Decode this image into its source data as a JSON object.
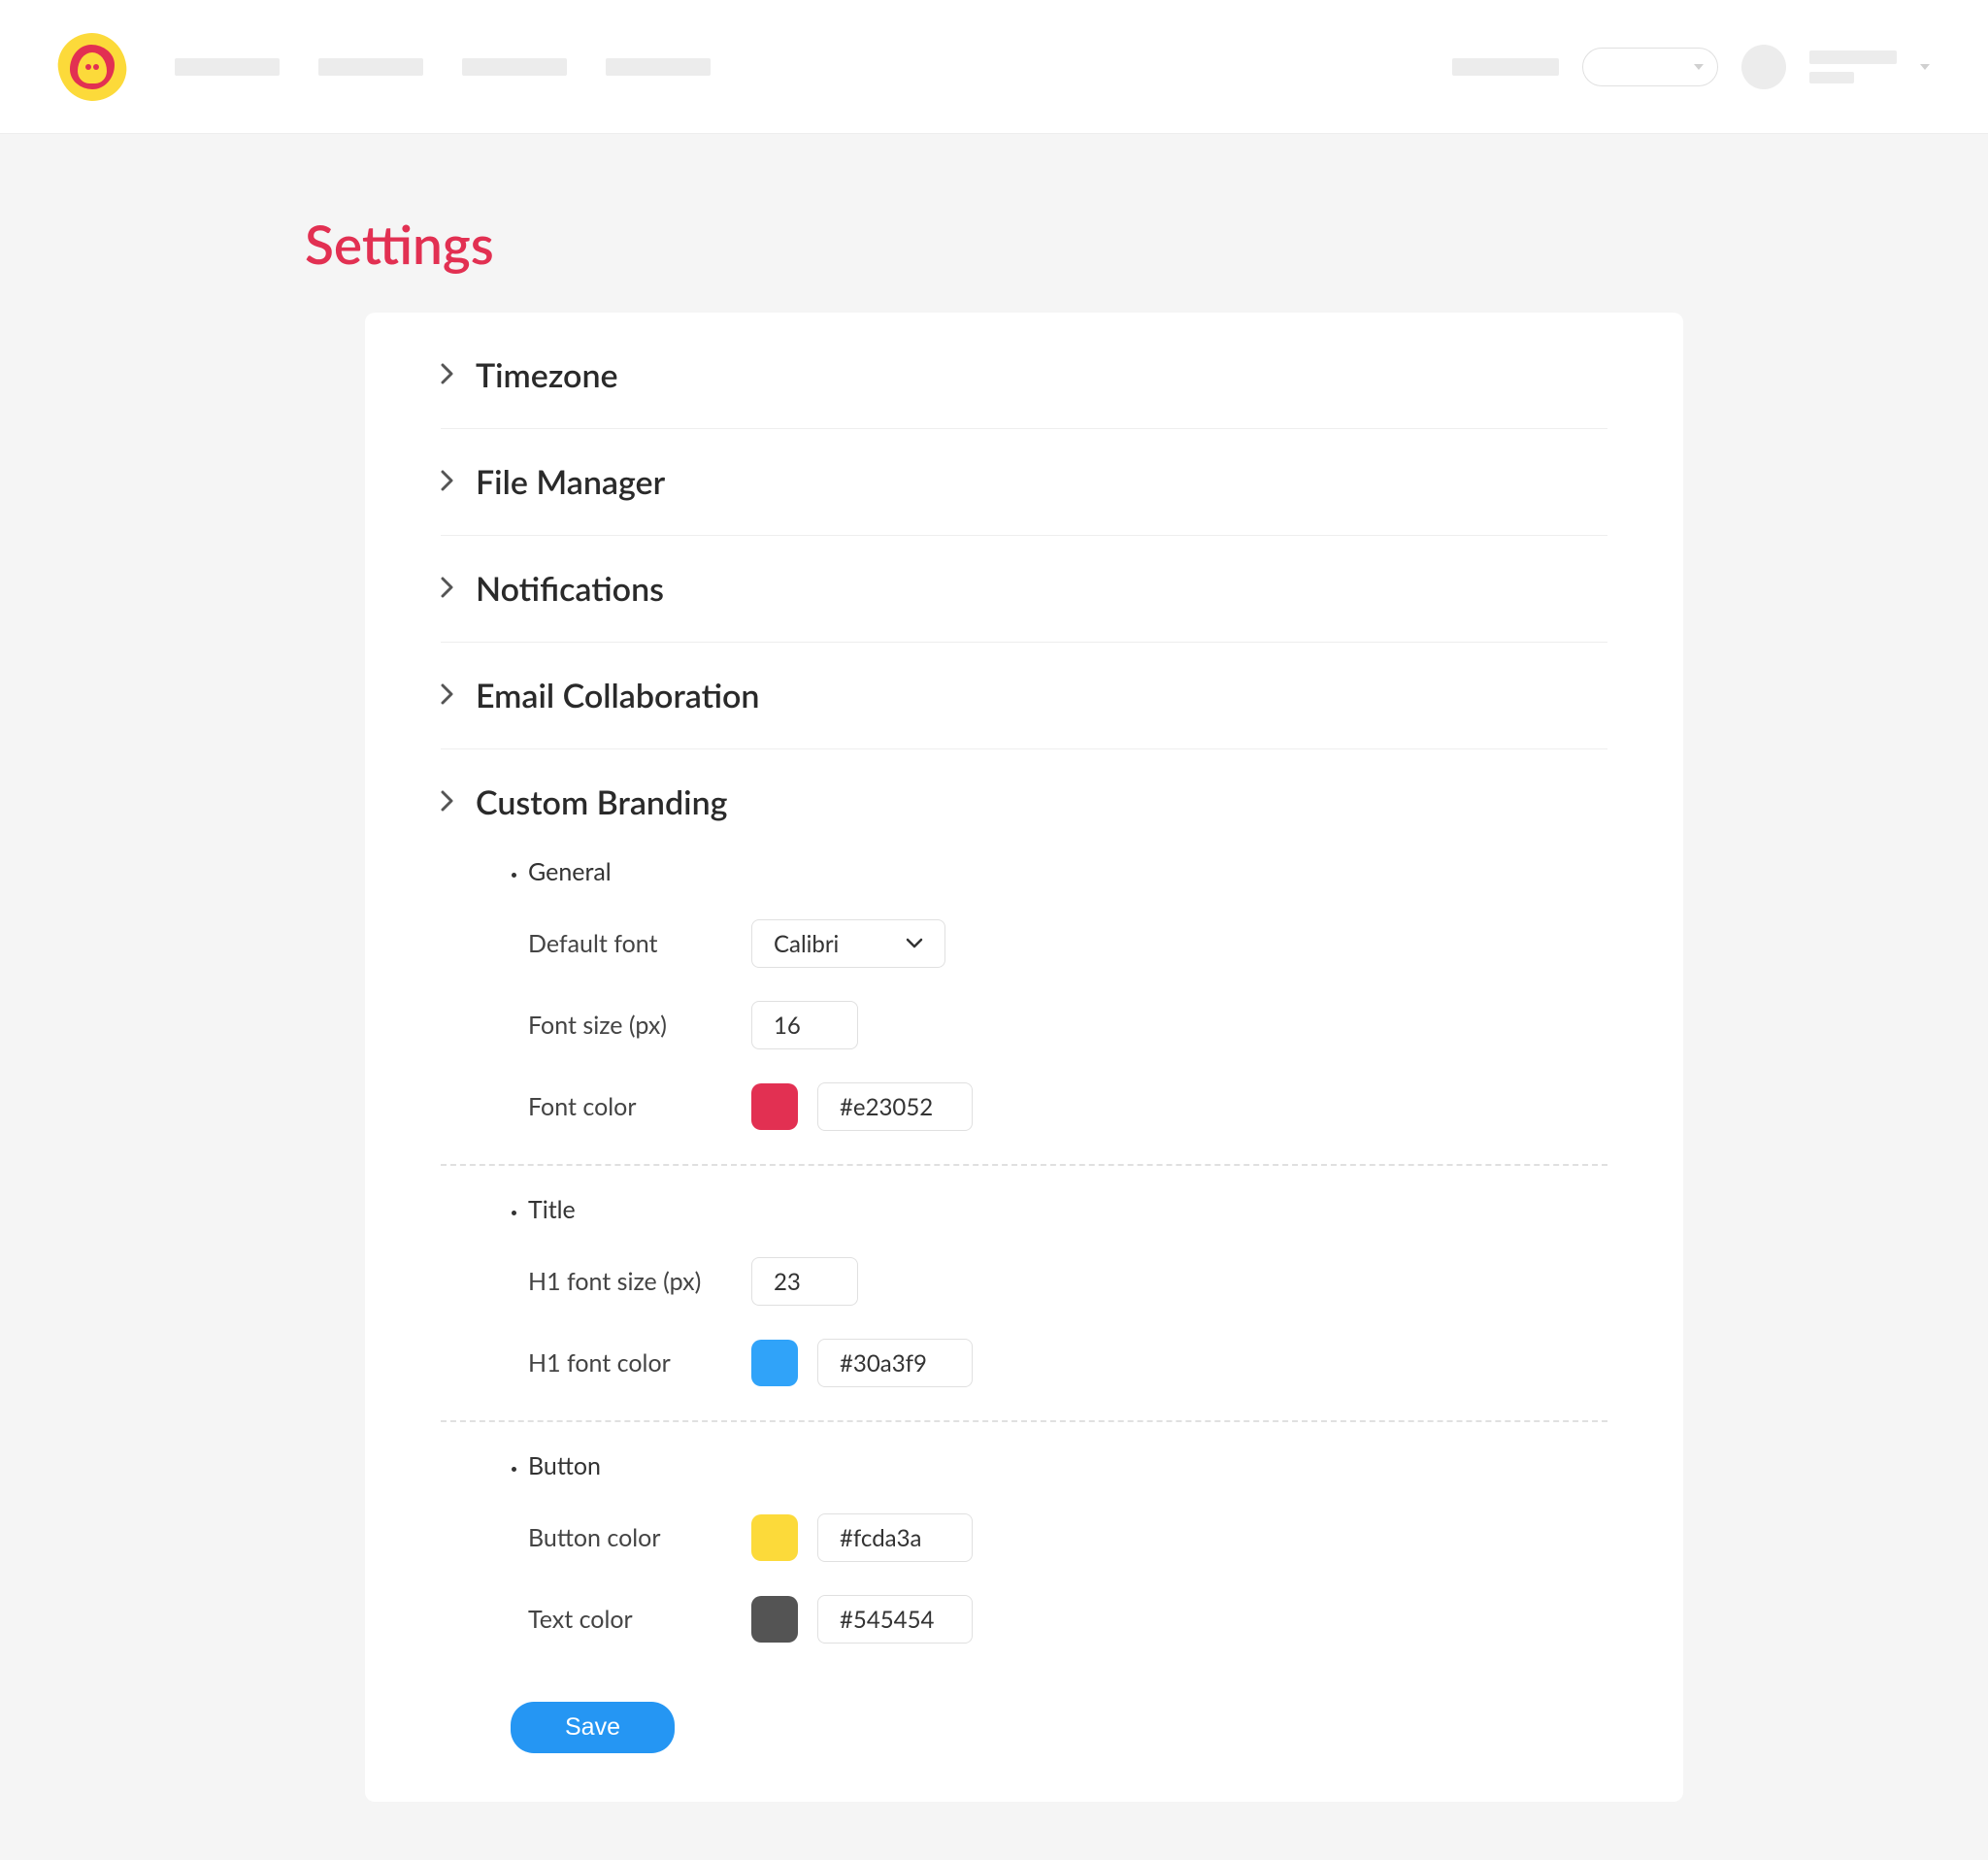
{
  "page": {
    "title": "Settings"
  },
  "sections": {
    "timezone": "Timezone",
    "file_manager": "File Manager",
    "notifications": "Notifications",
    "email_collab": "Email Collaboration",
    "custom_branding": "Custom Branding"
  },
  "branding": {
    "general": {
      "label": "General",
      "default_font_label": "Default font",
      "default_font_value": "Calibri",
      "font_size_label": "Font size (px)",
      "font_size_value": "16",
      "font_color_label": "Font color",
      "font_color_value": "#e23052"
    },
    "title": {
      "label": "Title",
      "h1_size_label": "H1 font size (px)",
      "h1_size_value": "23",
      "h1_color_label": "H1 font color",
      "h1_color_value": "#30a3f9"
    },
    "button": {
      "label": "Button",
      "btn_color_label": "Button color",
      "btn_color_value": "#fcda3a",
      "text_color_label": "Text color",
      "text_color_value": "#545454"
    }
  },
  "actions": {
    "save": "Save"
  }
}
